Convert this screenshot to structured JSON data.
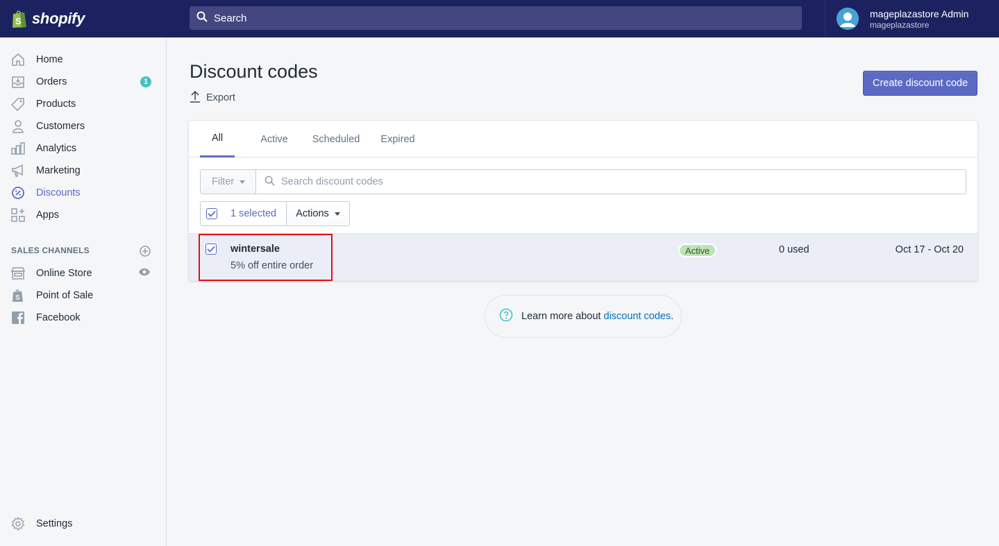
{
  "brand": {
    "name": "shopify"
  },
  "search": {
    "placeholder": "Search"
  },
  "user": {
    "name": "mageplazastore Admin",
    "store": "mageplazastore"
  },
  "sidebar": {
    "items": [
      {
        "label": "Home",
        "icon": "home-icon"
      },
      {
        "label": "Orders",
        "icon": "orders-icon",
        "badge": "1"
      },
      {
        "label": "Products",
        "icon": "tag-icon"
      },
      {
        "label": "Customers",
        "icon": "person-icon"
      },
      {
        "label": "Analytics",
        "icon": "bar-chart-icon"
      },
      {
        "label": "Marketing",
        "icon": "megaphone-icon"
      },
      {
        "label": "Discounts",
        "icon": "discount-icon",
        "active": true
      },
      {
        "label": "Apps",
        "icon": "apps-icon"
      }
    ],
    "channels_heading": "SALES CHANNELS",
    "channels": [
      {
        "label": "Online Store",
        "icon": "store-icon"
      },
      {
        "label": "Point of Sale",
        "icon": "pos-bag-icon"
      },
      {
        "label": "Facebook",
        "icon": "facebook-icon"
      }
    ],
    "settings_label": "Settings"
  },
  "page": {
    "title": "Discount codes",
    "export_label": "Export",
    "create_label": "Create discount code"
  },
  "tabs": [
    "All",
    "Active",
    "Scheduled",
    "Expired"
  ],
  "filter": {
    "label": "Filter",
    "search_placeholder": "Search discount codes"
  },
  "bulk": {
    "selected_label": "1 selected",
    "actions_label": "Actions"
  },
  "discounts": [
    {
      "code": "wintersale",
      "description": "5% off entire order",
      "status": "Active",
      "usage": "0 used",
      "dates": "Oct 17 - Oct 20"
    }
  ],
  "help": {
    "prefix": "Learn more about ",
    "link": "discount codes",
    "suffix": "."
  },
  "colors": {
    "topbar": "#1c2260",
    "accent": "#5c6ac4",
    "active_badge": "#bbe5b3",
    "highlight": "#e01010"
  }
}
